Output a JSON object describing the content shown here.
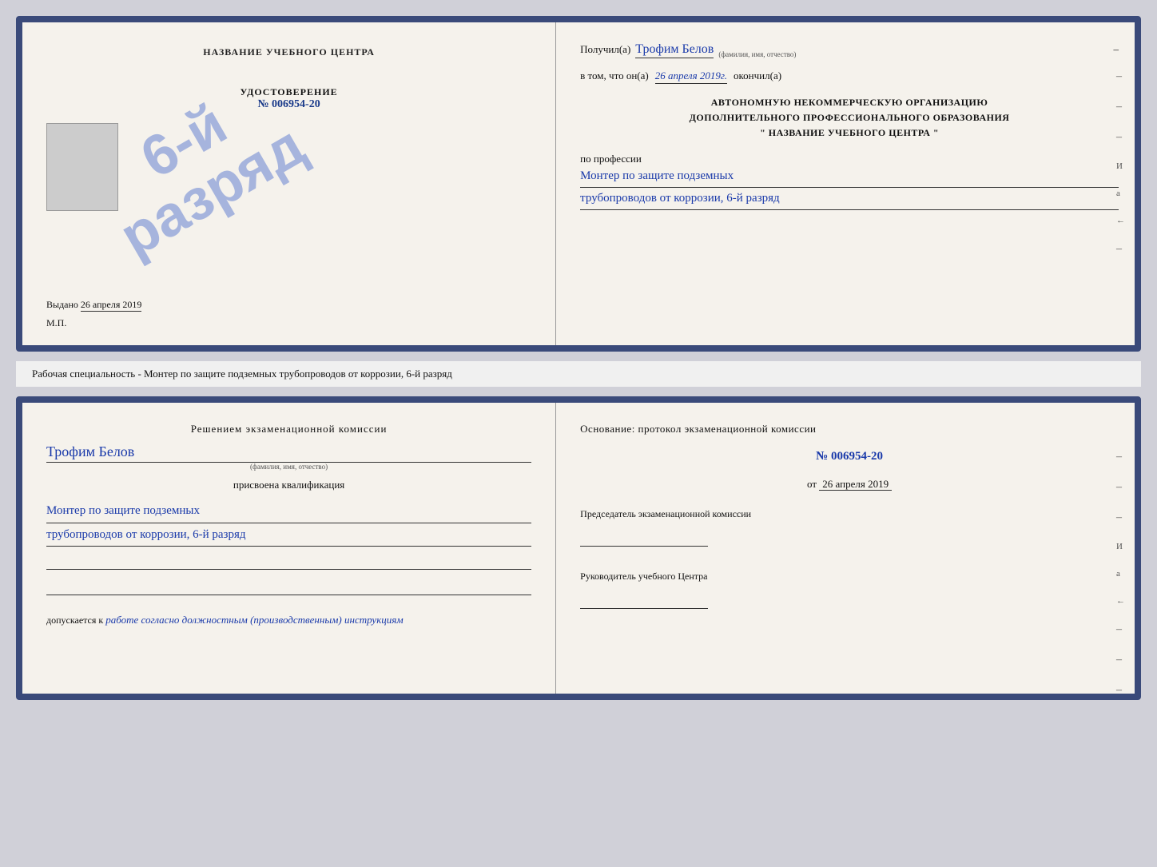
{
  "page": {
    "background_color": "#d0d0d8"
  },
  "top_cert": {
    "left": {
      "center_title": "НАЗВАНИЕ УЧЕБНОГО ЦЕНТРА",
      "cert_label": "УДОСТОВЕРЕНИЕ",
      "cert_number_prefix": "№",
      "cert_number": "006954-20",
      "stamp_line1": "6-й",
      "stamp_line2": "разряд",
      "issued_label": "Выдано",
      "issued_date": "26 апреля 2019",
      "mp_label": "М.П."
    },
    "right": {
      "received_label": "Получил(а)",
      "recipient_name": "Трофим Белов",
      "fio_label": "(фамилия, имя, отчество)",
      "date_prefix": "в том, что он(а)",
      "date_value": "26 апреля 2019г.",
      "completed_label": "окончил(а)",
      "org_line1": "АВТОНОМНУЮ НЕКОММЕРЧЕСКУЮ ОРГАНИЗАЦИЮ",
      "org_line2": "ДОПОЛНИТЕЛЬНОГО ПРОФЕССИОНАЛЬНОГО ОБРАЗОВАНИЯ",
      "org_line3": "\"   НАЗВАНИЕ УЧЕБНОГО ЦЕНТРА   \"",
      "profession_label": "по профессии",
      "profession_line1": "Монтер по защите подземных",
      "profession_line2": "трубопроводов от коррозии, 6-й разряд"
    }
  },
  "middle_text": "Рабочая специальность - Монтер по защите подземных трубопроводов от коррозии, 6-й разряд",
  "bottom_cert": {
    "left": {
      "commission_title": "Решением  экзаменационной  комиссии",
      "recipient_name": "Трофим Белов",
      "fio_label": "(фамилия, имя, отчество)",
      "qualification_label": "присвоена квалификация",
      "qualification_line1": "Монтер по защите подземных",
      "qualification_line2": "трубопроводов от коррозии, 6-й разряд",
      "admitted_prefix": "допускается к",
      "admitted_text": "работе согласно должностным (производственным) инструкциям"
    },
    "right": {
      "basis_title": "Основание:  протокол  экзаменационной  комиссии",
      "protocol_prefix": "№",
      "protocol_number": "006954-20",
      "date_prefix": "от",
      "date_value": "26 апреля 2019",
      "chairman_label": "Председатель экзаменационной комиссии",
      "director_label": "Руководитель учебного Центра"
    }
  },
  "right_marks": {
    "marks": [
      "–",
      "–",
      "–",
      "И",
      "а",
      "←",
      "–",
      "–",
      "–",
      "–",
      "–"
    ]
  }
}
